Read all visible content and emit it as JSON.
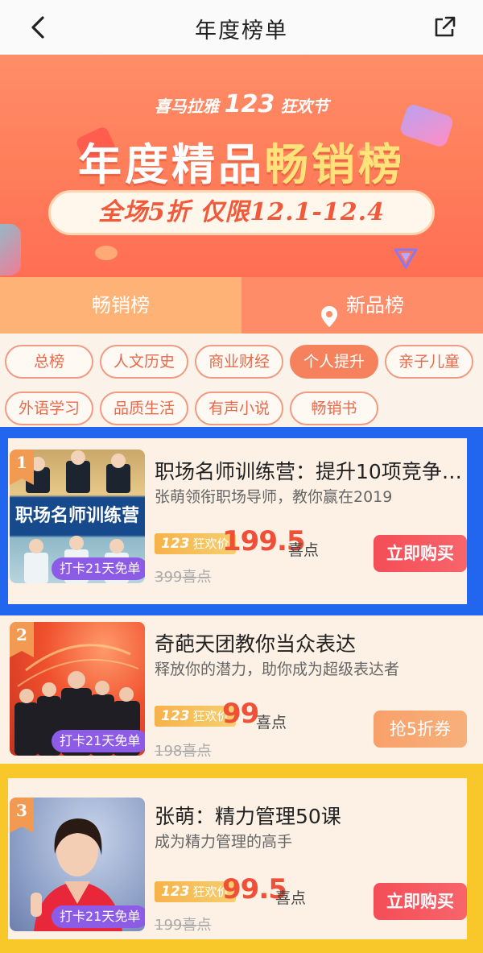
{
  "nav": {
    "title": "年度榜单",
    "back_icon": "chevron-left-icon",
    "share_icon": "external-share-icon"
  },
  "banner": {
    "brand": "喜马拉雅",
    "brand_num": "123",
    "brand_suffix": "狂欢节",
    "headline_a": "年度精品",
    "headline_b": "畅销榜",
    "promo": "全场5折  仅限12.1-12.4"
  },
  "tabs": [
    {
      "label": "畅销榜"
    },
    {
      "label": "新品榜",
      "icon": "location-pin-icon"
    }
  ],
  "categories": [
    {
      "label": "总榜"
    },
    {
      "label": "人文历史"
    },
    {
      "label": "商业财经"
    },
    {
      "label": "个人提升",
      "active": true
    },
    {
      "label": "亲子儿童"
    },
    {
      "label": "外语学习"
    },
    {
      "label": "品质生活"
    },
    {
      "label": "有声小说"
    },
    {
      "label": "畅销书"
    }
  ],
  "products": [
    {
      "rank": "1",
      "cover_text": "职场名师训练营",
      "badge": "打卡21天免单",
      "title": "职场名师训练营：提升10项竞争…",
      "subtitle": "张萌领衔职场导师，教你赢在2019",
      "tag_num": "123",
      "tag_text": "狂欢价",
      "price": "199.5",
      "unit": "喜点",
      "original": "399喜点",
      "button": "立即购买"
    },
    {
      "rank": "2",
      "badge": "打卡21天免单",
      "title": "奇葩天团教你当众表达",
      "subtitle": "释放你的潜力，助你成为超级表达者",
      "tag_num": "123",
      "tag_text": "狂欢价",
      "price": "99",
      "unit": "喜点",
      "original": "198喜点",
      "button": "抢5折券"
    },
    {
      "rank": "3",
      "badge": "打卡21天免单",
      "title": "张萌：精力管理50课",
      "subtitle": "成为精力管理的高手",
      "tag_num": "123",
      "tag_text": "狂欢价",
      "price": "99.5",
      "unit": "喜点",
      "original": "199喜点",
      "button": "立即购买"
    }
  ],
  "colors": {
    "accent": "#f05038",
    "selection_blue": "#2266f0",
    "selection_yellow": "#f8c72a",
    "active_chip": "#f5825c"
  }
}
